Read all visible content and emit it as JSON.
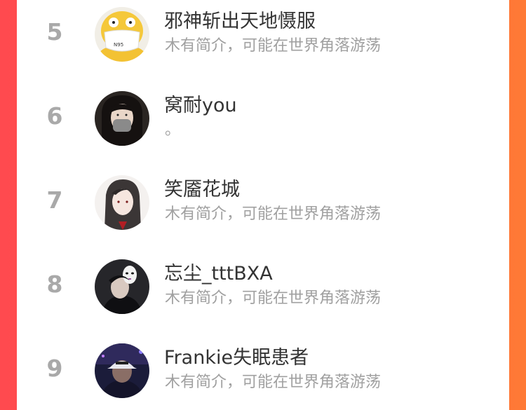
{
  "ranking": {
    "items": [
      {
        "rank": "5",
        "name": "邪神斩出天地慑服",
        "bio": "木有简介，可能在世界角落游荡",
        "avatar_icon": "psyduck-mask-avatar",
        "mask_text": "N95"
      },
      {
        "rank": "6",
        "name": "窝耐you",
        "bio": "。",
        "avatar_icon": "girl-mask-avatar"
      },
      {
        "rank": "7",
        "name": "笑靥花城",
        "bio": "木有简介，可能在世界角落游荡",
        "avatar_icon": "anime-boy-avatar"
      },
      {
        "rank": "8",
        "name": "忘尘_tttBXA",
        "bio": "木有简介，可能在世界角落游荡",
        "avatar_icon": "noface-mask-avatar"
      },
      {
        "rank": "9",
        "name": "Frankie失眠患者",
        "bio": "木有简介，可能在世界角落游荡",
        "avatar_icon": "cap-guy-avatar"
      }
    ]
  },
  "colors": {
    "background_left": "#ff4a4f",
    "background_right": "#ff7a35",
    "rank_gray": "#a9a9a9",
    "name": "#333333",
    "bio": "#a0a0a0"
  }
}
